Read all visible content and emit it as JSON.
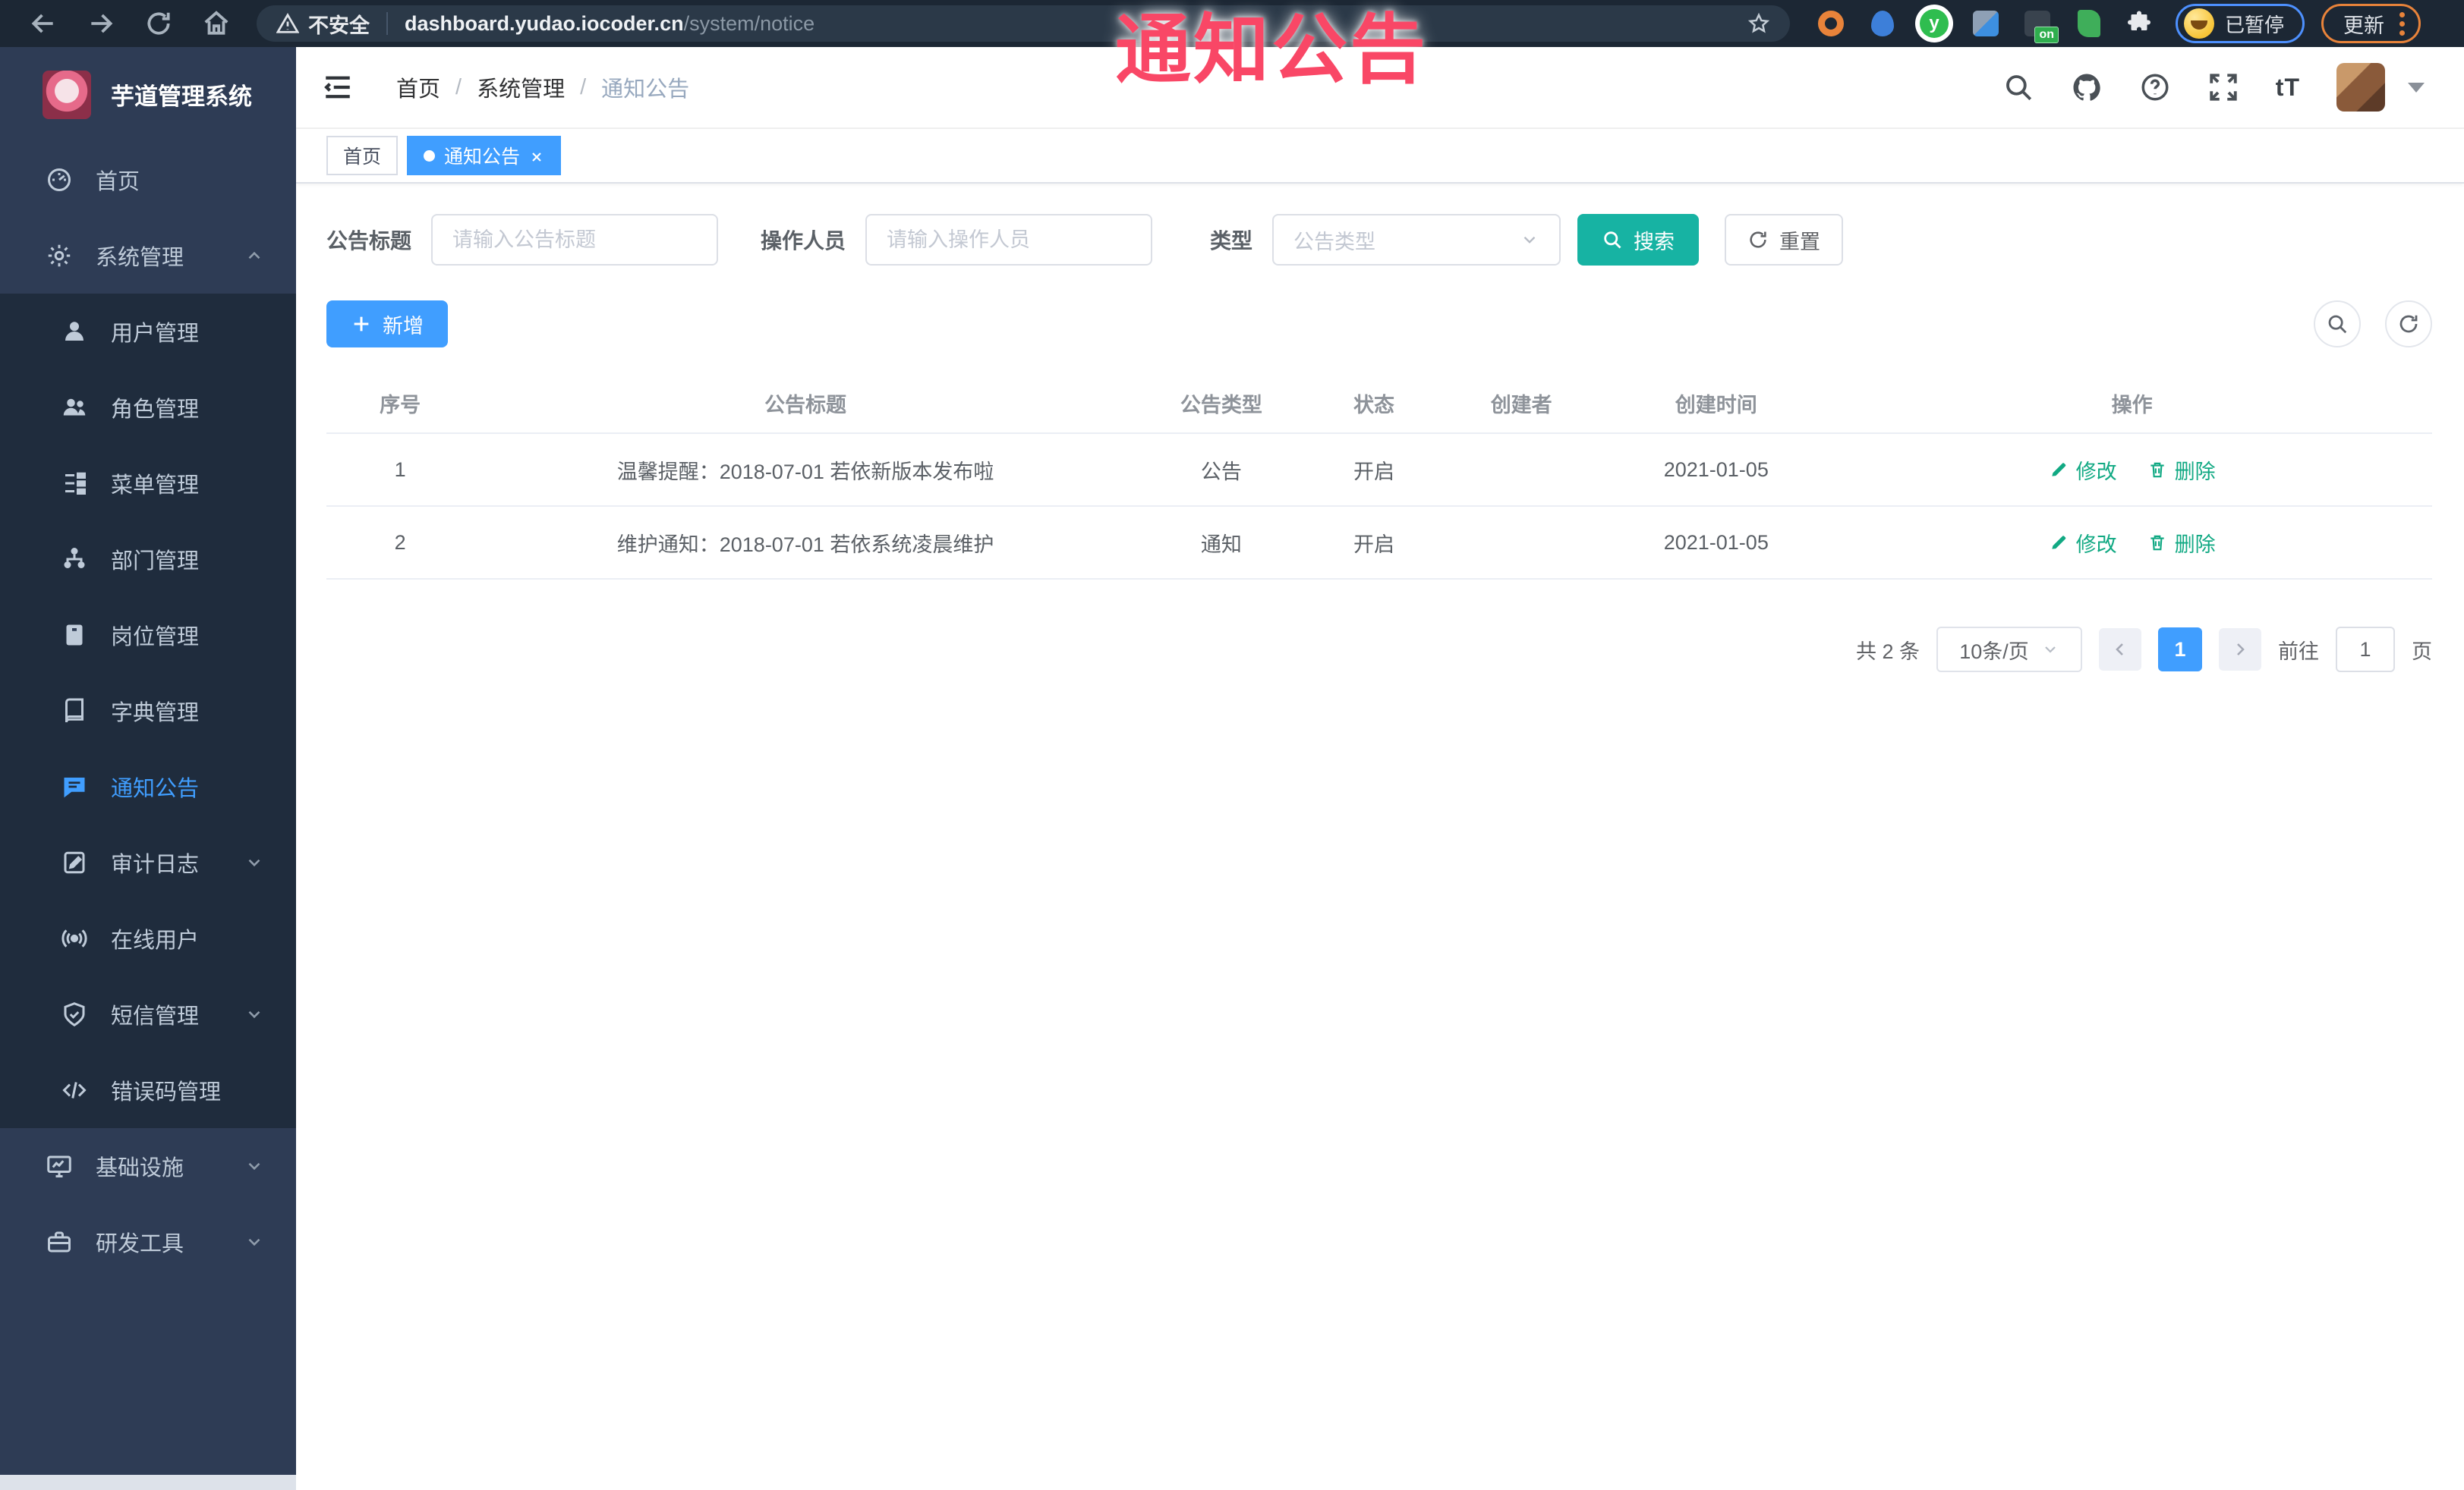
{
  "annotation": {
    "text": "通知公告"
  },
  "browser": {
    "secure_label": "不安全",
    "url_host": "dashboard.yudao.iocoder.cn",
    "url_path": "/system/notice",
    "extension_on_badge": "on",
    "profile_paused_badge": "已暂停",
    "update_button": "更新"
  },
  "sidebar": {
    "logo_title": "芋道管理系统",
    "items": [
      {
        "label": "首页",
        "icon": "dashboard"
      },
      {
        "label": "系统管理",
        "icon": "gear",
        "expanded": true
      },
      {
        "label": "用户管理",
        "icon": "user"
      },
      {
        "label": "角色管理",
        "icon": "users"
      },
      {
        "label": "菜单管理",
        "icon": "menu-tree"
      },
      {
        "label": "部门管理",
        "icon": "org-chart"
      },
      {
        "label": "岗位管理",
        "icon": "badge"
      },
      {
        "label": "字典管理",
        "icon": "book"
      },
      {
        "label": "通知公告",
        "icon": "message",
        "active": true
      },
      {
        "label": "审计日志",
        "icon": "log",
        "chevron": "down"
      },
      {
        "label": "在线用户",
        "icon": "broadcast"
      },
      {
        "label": "短信管理",
        "icon": "shield",
        "chevron": "down"
      },
      {
        "label": "错误码管理",
        "icon": "code"
      },
      {
        "label": "基础设施",
        "icon": "monitor",
        "chevron": "down"
      },
      {
        "label": "研发工具",
        "icon": "toolbox",
        "chevron": "down"
      }
    ]
  },
  "header": {
    "breadcrumb": [
      "首页",
      "系统管理",
      "通知公告"
    ],
    "separator": "/",
    "font_size_icon_text": "tT"
  },
  "tags": {
    "home": "首页",
    "active_tab": "通知公告"
  },
  "filters": {
    "title_label": "公告标题",
    "title_placeholder": "请输入公告标题",
    "operator_label": "操作人员",
    "operator_placeholder": "请输入操作人员",
    "type_label": "类型",
    "type_placeholder": "公告类型",
    "search_label": "搜索",
    "reset_label": "重置"
  },
  "toolbar": {
    "add_label": "新增"
  },
  "table": {
    "columns": [
      "序号",
      "公告标题",
      "公告类型",
      "状态",
      "创建者",
      "创建时间",
      "操作"
    ],
    "edit_label": "修改",
    "delete_label": "删除",
    "rows": [
      {
        "no": "1",
        "title": "温馨提醒：2018-07-01 若依新版本发布啦",
        "type": "公告",
        "status": "开启",
        "creator": "",
        "created": "2021-01-05"
      },
      {
        "no": "2",
        "title": "维护通知：2018-07-01 若依系统凌晨维护",
        "type": "通知",
        "status": "开启",
        "creator": "",
        "created": "2021-01-05"
      }
    ]
  },
  "pagination": {
    "total_text": "共 2 条",
    "page_size": "10条/页",
    "current_page": "1",
    "goto_label": "前往",
    "goto_value": "1",
    "page_unit": "页"
  }
}
